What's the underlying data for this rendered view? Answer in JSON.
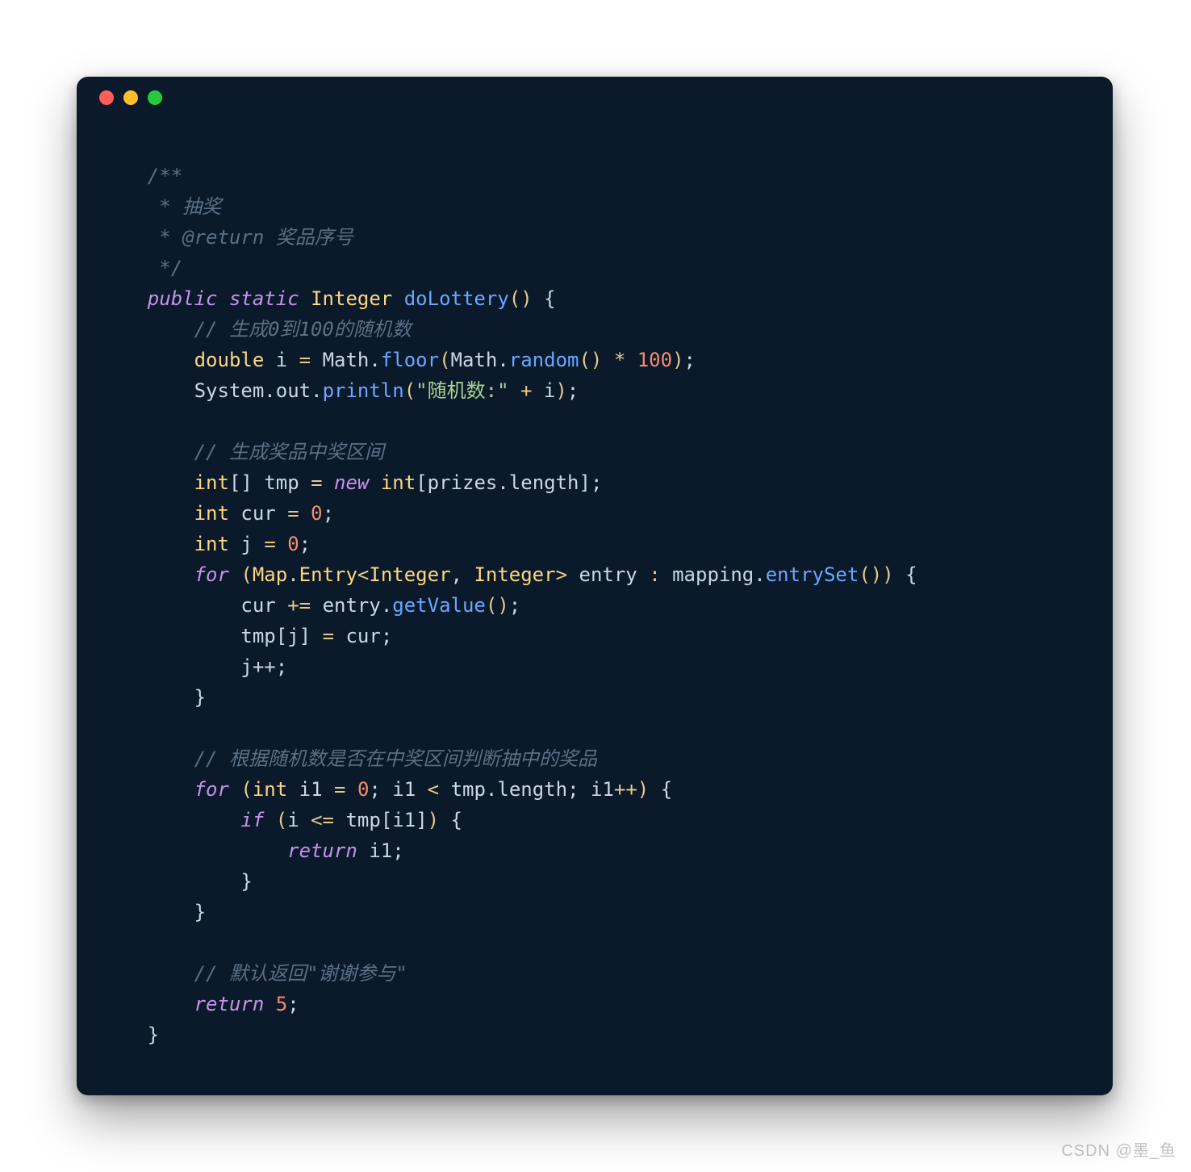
{
  "window": {
    "dots": [
      "red",
      "yellow",
      "green"
    ]
  },
  "watermark": "CSDN @墨_鱼",
  "code": {
    "c1": "/**",
    "c2": " * 抽奖",
    "c3": " * @return 奖品序号",
    "c4": " */",
    "kw_public": "public",
    "kw_static": "static",
    "ty_Integer": "Integer",
    "fn_doLottery": "doLottery",
    "lbrace": "{",
    "rbrace": "}",
    "paren_open": "(",
    "paren_close": ")",
    "c_rand": "// 生成0到100的随机数",
    "dbl": "double",
    "id_i": "i",
    "eq": "=",
    "id_Math": "Math",
    "dot": ".",
    "fn_floor": "floor",
    "fn_random": "random",
    "star": "*",
    "n100": "100",
    "semi": ";",
    "id_System": "System",
    "id_out": "out",
    "fn_println": "println",
    "str_rand": "\"随机数:\"",
    "plus": "+",
    "c_zone": "// 生成奖品中奖区间",
    "ty_int": "int",
    "arr_br": "[]",
    "id_tmp": "tmp",
    "kw_new": "new",
    "lbr": "[",
    "rbr": "]",
    "id_prizes": "prizes",
    "id_length": "length",
    "id_cur": "cur",
    "n0": "0",
    "id_j": "j",
    "kw_for": "for",
    "ty_Map": "Map",
    "ty_Entry": "Entry",
    "lt": "<",
    "gt": ">",
    "comma": ",",
    "id_entry": "entry",
    "colon": ":",
    "id_mapping": "mapping",
    "fn_entrySet": "entrySet",
    "pluseq": "+=",
    "fn_getValue": "getValue",
    "id_jpp": "j++",
    "c_judge": "// 根据随机数是否在中奖区间判断抽中的奖品",
    "id_i1": "i1",
    "pp": "++",
    "kw_if": "if",
    "le": "<=",
    "kw_return": "return",
    "c_default": "// 默认返回\"谢谢参与\"",
    "n5": "5",
    "sp1": "    ",
    "sp2": "        ",
    "sp3": "            ",
    "sp4": "                "
  }
}
